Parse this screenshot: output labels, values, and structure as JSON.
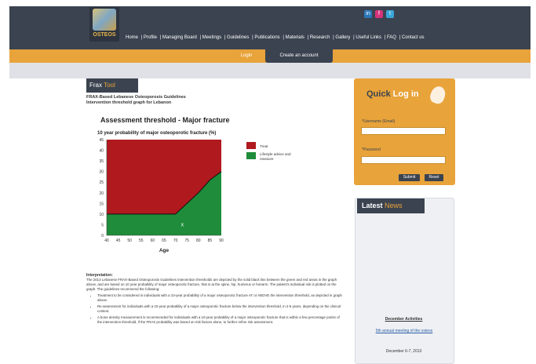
{
  "header": {
    "logo_text": "OSTEOS",
    "social_icons": [
      "linkedin-icon",
      "flickr-icon",
      "twitter-icon"
    ],
    "nav": [
      "Home",
      "Profile",
      "Managing Board",
      "Meetings",
      "Guidelines",
      "Publications",
      "Materials",
      "Research",
      "Gallery",
      "Useful Links",
      "FAQ",
      "Contact us"
    ]
  },
  "subnav": {
    "login": "Login",
    "create_account": "Create an account"
  },
  "frax": {
    "tab_title": "Frax",
    "tab_accent": "Tool",
    "subtitle_line1": "FRAX-Based Lebanese Osteoporosis Guidelines",
    "subtitle_line2": "Intervention threshold graph for Lebanon"
  },
  "chart_data": {
    "type": "area",
    "title": "Assessment threshold - Major fracture",
    "ylabel": "10 year probability of major osteoporotic fracture (%)",
    "xlabel": "Age",
    "x": [
      40,
      45,
      50,
      55,
      60,
      65,
      70,
      75,
      80,
      85,
      90
    ],
    "ylim": [
      0,
      45
    ],
    "yticks": [
      0,
      5,
      10,
      15,
      20,
      25,
      30,
      35,
      40,
      45
    ],
    "series": [
      {
        "name": "Treat",
        "color": "#b0191e",
        "upper": [
          45,
          45,
          45,
          45,
          45,
          45,
          45,
          45,
          45,
          45,
          45
        ]
      },
      {
        "name": "Lifestyle advice and reassure",
        "color": "#1e8c3a",
        "values": [
          10,
          10,
          10,
          10,
          10,
          10,
          10,
          15,
          20,
          26,
          30
        ]
      }
    ],
    "marker": {
      "x": 73,
      "y": 5,
      "label": "x"
    },
    "legend": "right"
  },
  "interpretation": {
    "heading": "Interpretation:",
    "intro": "The 2013 Lebanese FRAX-Based Osteoporosis Guidelines intervention thresholds are depicted by the solid black line between the green and red areas in the graph above, and are based on 10 year probability of major osteoporotic fracture, that is at the spine, hip, humerus or forearm. The patient's individual risk is plotted on the graph. The guidelines recommend the following:",
    "bullets": [
      "Treatment to be considered in individuals with a 10-year probability of a major osteoporotic fracture AT or ABOVE the intervention threshold, as depicted in graph above.",
      "Re-assessment for individuals with a 10-year probability of a major osteoporotic fracture below the intervention threshold, in 2-5 years, depending on the clinical context.",
      "A bone density measurement is recommended for individuals with a 10-year probability of a major osteoporotic fracture that is within a few percentage points of the intervention threshold, if the FRAX probability was based on risk factors alone, to further refine risk assessment."
    ]
  },
  "quick_login": {
    "title": "Quick",
    "title_accent": "Log in",
    "username_label": "*Username (Email)",
    "password_label": "*Password",
    "submit": "Submit",
    "reset": "Reset"
  },
  "latest_news": {
    "title": "Latest",
    "title_accent": "News",
    "items": [
      "December Activities",
      "5th annual meeting of the osteos",
      "December 6-7, 2013"
    ]
  },
  "colors": {
    "header": "#3b4350",
    "accent": "#e8a33a",
    "treat": "#b0191e",
    "lifestyle": "#1e8c3a"
  }
}
